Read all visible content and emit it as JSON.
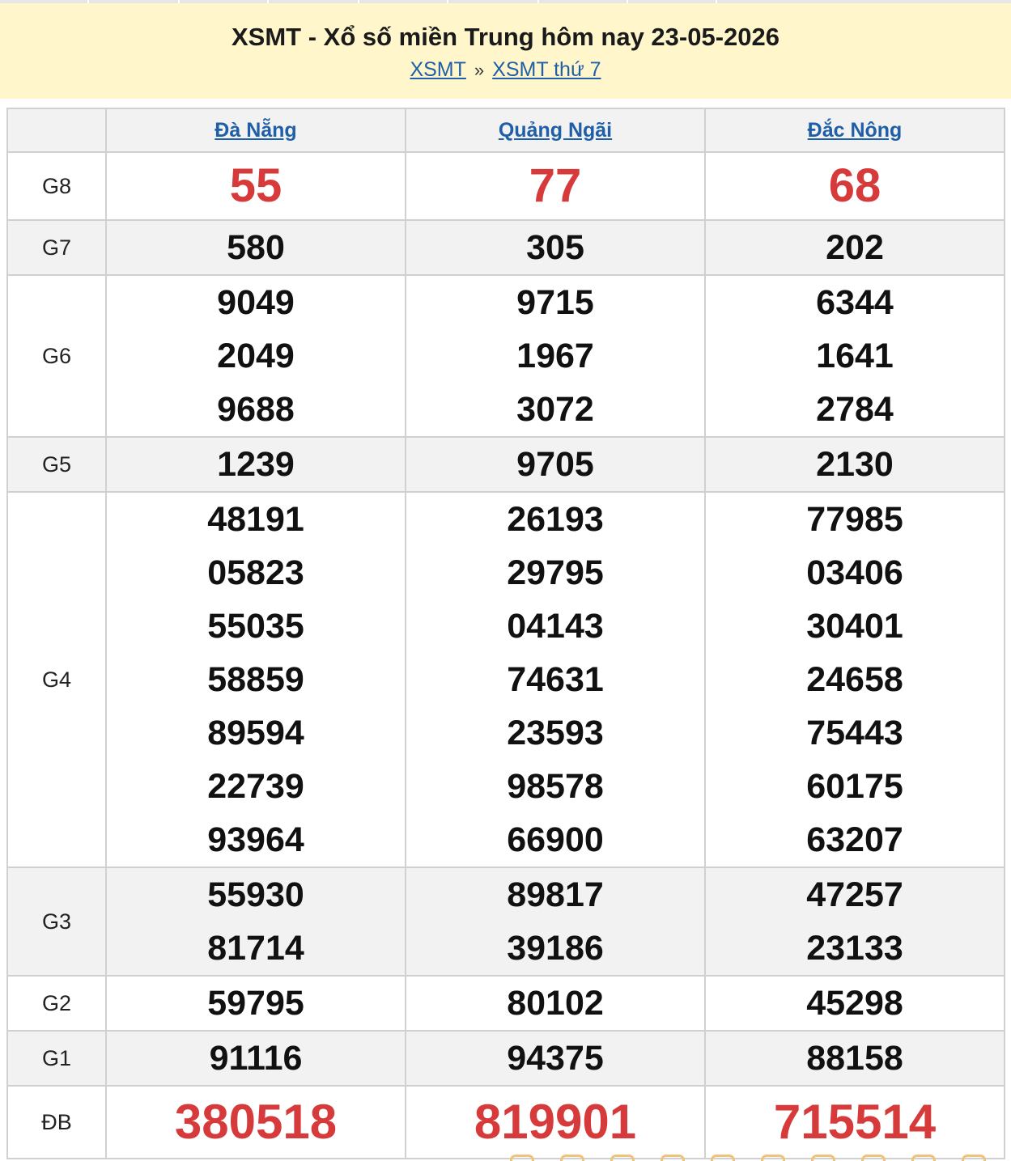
{
  "header": {
    "title": "XSMT - Xổ số miền Trung hôm nay 23-05-2026",
    "breadcrumb_home": "XSMT",
    "breadcrumb_sep": "»",
    "breadcrumb_day": "XSMT thứ 7"
  },
  "provinces": [
    "Đà Nẵng",
    "Quảng Ngãi",
    "Đắc Nông"
  ],
  "prizes": [
    {
      "label": "G8",
      "values": [
        [
          "55"
        ],
        [
          "77"
        ],
        [
          "68"
        ]
      ]
    },
    {
      "label": "G7",
      "values": [
        [
          "580"
        ],
        [
          "305"
        ],
        [
          "202"
        ]
      ]
    },
    {
      "label": "G6",
      "values": [
        [
          "9049",
          "2049",
          "9688"
        ],
        [
          "9715",
          "1967",
          "3072"
        ],
        [
          "6344",
          "1641",
          "2784"
        ]
      ]
    },
    {
      "label": "G5",
      "values": [
        [
          "1239"
        ],
        [
          "9705"
        ],
        [
          "2130"
        ]
      ]
    },
    {
      "label": "G4",
      "values": [
        [
          "48191",
          "05823",
          "55035",
          "58859",
          "89594",
          "22739",
          "93964"
        ],
        [
          "26193",
          "29795",
          "04143",
          "74631",
          "23593",
          "98578",
          "66900"
        ],
        [
          "77985",
          "03406",
          "30401",
          "24658",
          "75443",
          "60175",
          "63207"
        ]
      ]
    },
    {
      "label": "G3",
      "values": [
        [
          "55930",
          "81714"
        ],
        [
          "89817",
          "39186"
        ],
        [
          "47257",
          "23133"
        ]
      ]
    },
    {
      "label": "G2",
      "values": [
        [
          "59795"
        ],
        [
          "80102"
        ],
        [
          "45298"
        ]
      ]
    },
    {
      "label": "G1",
      "values": [
        [
          "91116"
        ],
        [
          "94375"
        ],
        [
          "88158"
        ]
      ]
    },
    {
      "label": "ĐB",
      "values": [
        [
          "380518"
        ],
        [
          "819901"
        ],
        [
          "715514"
        ]
      ]
    }
  ],
  "colors": {
    "header_bg": "#fff6cc",
    "link": "#1f5fa8",
    "special_red": "#d63a3a",
    "row_alt": "#f2f2f2",
    "border": "#d0d0d0"
  }
}
